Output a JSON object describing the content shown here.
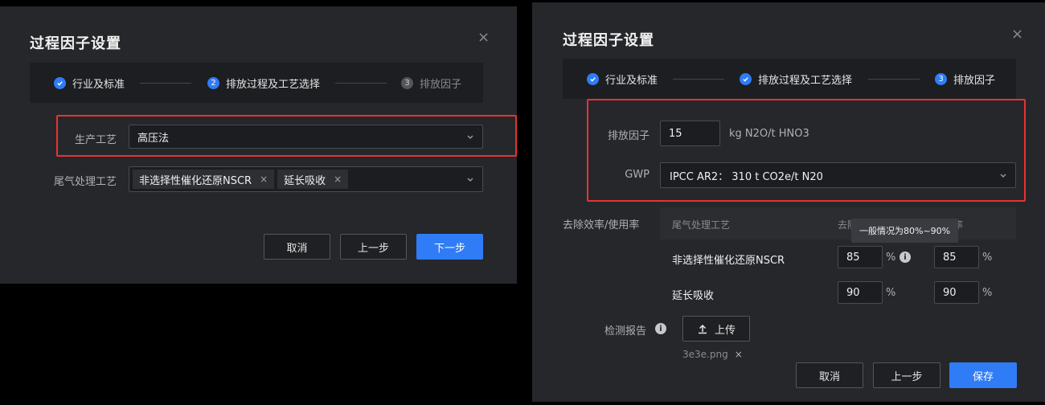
{
  "left": {
    "title": "过程因子设置",
    "close": "×",
    "steps": [
      {
        "label": "行业及标准",
        "status": "done",
        "num": ""
      },
      {
        "label": "排放过程及工艺选择",
        "status": "active",
        "num": "2"
      },
      {
        "label": "排放因子",
        "status": "pending",
        "num": "3"
      }
    ],
    "process_label": "生产工艺",
    "process_value": "高压法",
    "tail_label": "尾气处理工艺",
    "tail_tags": [
      "非选择性催化还原NSCR",
      "延长吸收"
    ],
    "tag_remove": "×",
    "buttons": {
      "cancel": "取消",
      "prev": "上一步",
      "next": "下一步"
    }
  },
  "right": {
    "title": "过程因子设置",
    "close": "×",
    "steps": [
      {
        "label": "行业及标准",
        "status": "done",
        "num": ""
      },
      {
        "label": "排放过程及工艺选择",
        "status": "done",
        "num": ""
      },
      {
        "label": "排放因子",
        "status": "active",
        "num": "3"
      }
    ],
    "factor_label": "排放因子",
    "factor_value": "15",
    "factor_unit": "kg N2O/t HNO3",
    "gwp_label": "GWP",
    "gwp_value": "IPCC AR2： 310 t CO2e/t N20",
    "removal_label": "去除效率/使用率",
    "table_headers": [
      "尾气处理工艺",
      "去除效率",
      "使用率"
    ],
    "tooltip": "一般情况为80%~90%",
    "rows": [
      {
        "name": "非选择性催化还原NSCR",
        "efficiency": "85",
        "usage": "85"
      },
      {
        "name": "延长吸收",
        "efficiency": "90",
        "usage": "90"
      }
    ],
    "percent": "%",
    "report_label": "检测报告",
    "upload_label": "上传",
    "file_name": "3e3e.png",
    "file_remove": "×",
    "buttons": {
      "cancel": "取消",
      "prev": "上一步",
      "save": "保存"
    }
  },
  "colors": {
    "accent": "#2f7cf6",
    "highlight": "#e83232",
    "modal_bg": "#26272b"
  }
}
